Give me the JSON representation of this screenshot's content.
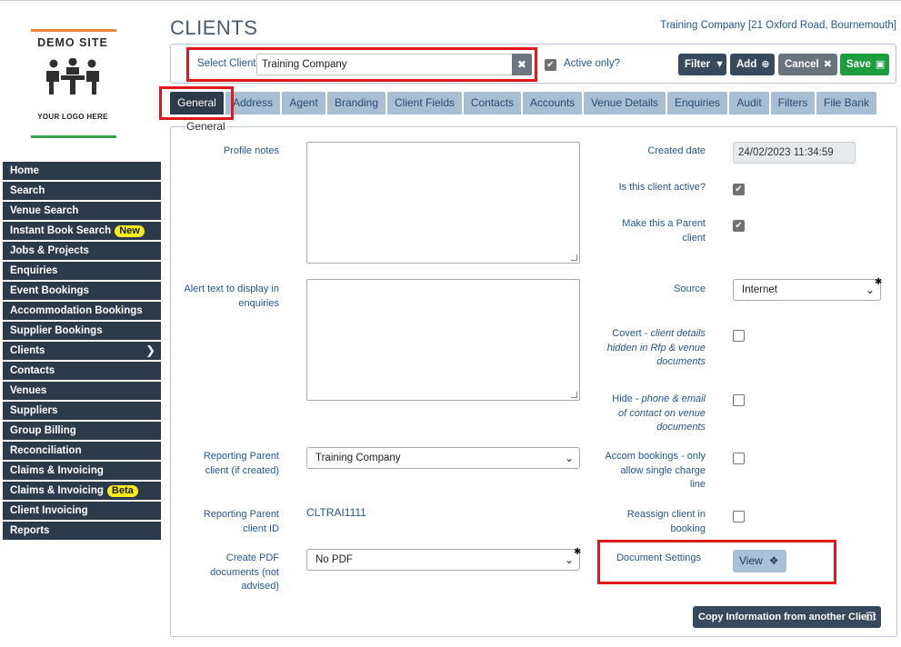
{
  "logo": {
    "site": "DEMO SITE",
    "tagline": "YOUR LOGO HERE"
  },
  "page": {
    "title": "CLIENTS",
    "company_link": "Training Company [21 Oxford Road, Bournemouth]"
  },
  "sidebar": {
    "items": [
      {
        "label": "Home"
      },
      {
        "label": "Search"
      },
      {
        "label": "Venue Search"
      },
      {
        "label": "Instant Book Search",
        "badge": "New"
      },
      {
        "label": "Jobs & Projects"
      },
      {
        "label": "Enquiries"
      },
      {
        "label": "Event Bookings"
      },
      {
        "label": "Accommodation Bookings"
      },
      {
        "label": "Supplier Bookings"
      },
      {
        "label": "Clients",
        "active": true
      },
      {
        "label": "Contacts"
      },
      {
        "label": "Venues"
      },
      {
        "label": "Suppliers"
      },
      {
        "label": "Group Billing"
      },
      {
        "label": "Reconciliation"
      },
      {
        "label": "Claims & Invoicing"
      },
      {
        "label": "Claims & Invoicing",
        "badge": "Beta"
      },
      {
        "label": "Client Invoicing"
      },
      {
        "label": "Reports"
      }
    ]
  },
  "client_bar": {
    "select_label": "Select Client",
    "client_value": "Training Company",
    "active_only_label": "Active only?",
    "active_only_checked": true,
    "buttons": {
      "filter": "Filter",
      "add": "Add",
      "cancel": "Cancel",
      "save": "Save"
    }
  },
  "tabs": [
    {
      "label": "General",
      "active": true
    },
    {
      "label": "Address"
    },
    {
      "label": "Agent"
    },
    {
      "label": "Branding"
    },
    {
      "label": "Client Fields"
    },
    {
      "label": "Contacts"
    },
    {
      "label": "Accounts"
    },
    {
      "label": "Venue Details"
    },
    {
      "label": "Enquiries"
    },
    {
      "label": "Audit"
    },
    {
      "label": "Filters"
    },
    {
      "label": "File Bank"
    }
  ],
  "general": {
    "legend": "General",
    "profile_notes_label": "Profile notes",
    "alert_text_label_1": "Alert text to display in",
    "alert_text_label_2": "enquiries",
    "reporting_parent_label_1": "Reporting Parent",
    "reporting_parent_label_2": "client (if created)",
    "reporting_parent_value": "Training Company",
    "reporting_parent_id_label_1": "Reporting Parent",
    "reporting_parent_id_label_2": "client ID",
    "reporting_parent_id_value": "CLTRAI1111",
    "create_pdf_label_1": "Create PDF",
    "create_pdf_label_2": "documents (not",
    "create_pdf_label_3": "advised)",
    "create_pdf_value": "No PDF",
    "created_date_label": "Created date",
    "created_date_value": "24/02/2023 11:34:59",
    "is_active_label": "Is this client active?",
    "is_active_checked": true,
    "make_parent_label_1": "Make this a Parent",
    "make_parent_label_2": "client",
    "make_parent_checked": true,
    "source_label": "Source",
    "source_value": "Internet",
    "covert_label_main": "Covert - ",
    "covert_label_italic_1": "client details",
    "covert_label_italic_2": "hidden in Rfp & venue",
    "covert_label_italic_3": "documents",
    "hide_label_main": "Hide - ",
    "hide_label_italic_1": "phone & email",
    "hide_label_italic_2": "of contact on venue",
    "hide_label_italic_3": "documents",
    "accom_label_1": "Accom bookings - only",
    "accom_label_2": "allow single charge",
    "accom_label_3": "line",
    "reassign_label_1": "Reassign client in",
    "reassign_label_2": "booking",
    "doc_settings_label": "Document Settings",
    "view_button": "View",
    "copy_button": "Copy Information from another Client"
  }
}
